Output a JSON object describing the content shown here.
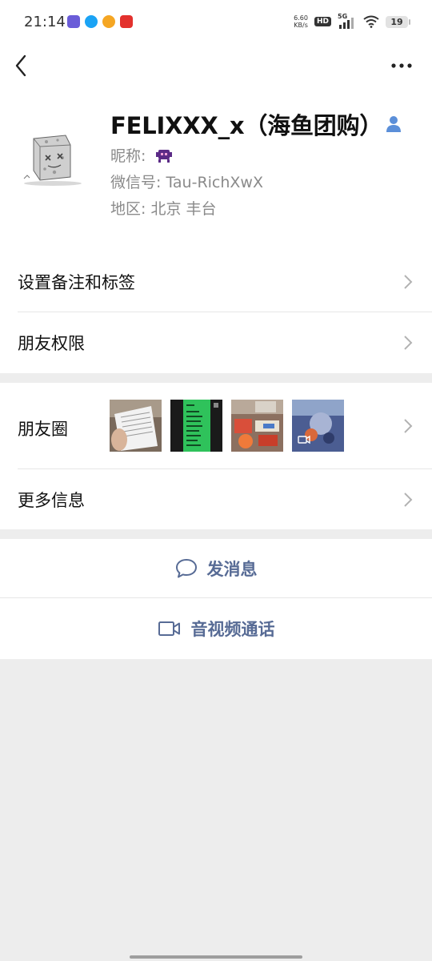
{
  "status_bar": {
    "time": "21:14",
    "net_speed": "6.60",
    "net_speed_unit": "KB/s",
    "hd": "HD",
    "network": "5G",
    "battery": "19"
  },
  "profile": {
    "name": "FELIXXX_x（海鱼团购）",
    "nickname_label": "昵称:",
    "wechat_id": "微信号: Tau-RichXwX",
    "region": "地区: 北京  丰台"
  },
  "menu": {
    "remark": "设置备注和标签",
    "permission": "朋友权限",
    "moments": "朋友圈",
    "more_info": "更多信息"
  },
  "actions": {
    "message": "发消息",
    "call": "音视频通话"
  },
  "colors": {
    "accent": "#576b95",
    "background": "#ededed",
    "verified_icon": "#5b8fd9"
  }
}
